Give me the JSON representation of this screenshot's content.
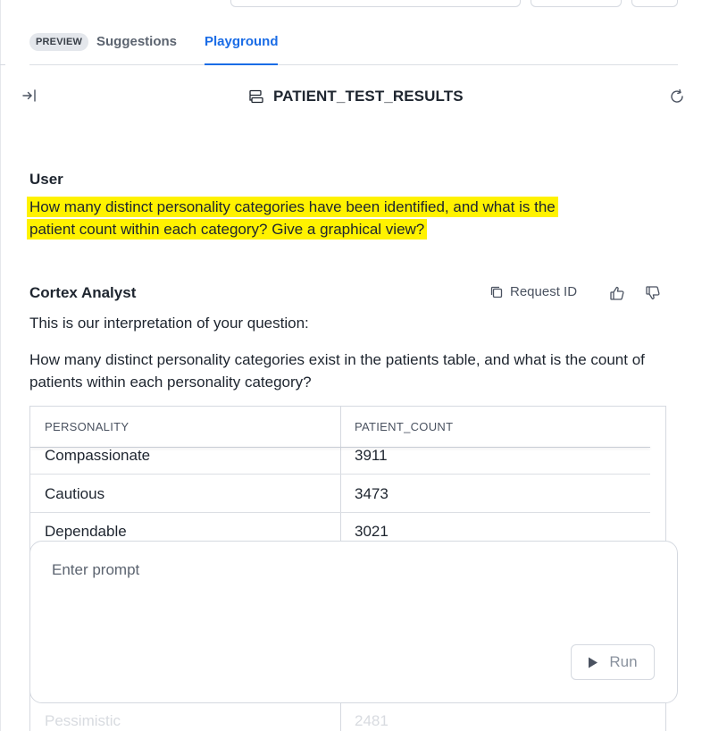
{
  "tabs": {
    "badge": "PREVIEW",
    "suggestions": "Suggestions",
    "playground": "Playground",
    "active": "Playground"
  },
  "header": {
    "title": "PATIENT_TEST_RESULTS"
  },
  "user": {
    "label": "User",
    "line1": "How many distinct personality categories have been identified, and what is the",
    "line2": "patient count within each category? Give a graphical view?"
  },
  "analyst": {
    "label": "Cortex Analyst",
    "request_id": "Request ID",
    "interpretation": "This is our interpretation of your question:",
    "question": "How many distinct personality categories exist in the patients table, and what is the count of patients within each personality category?"
  },
  "table": {
    "columns": [
      "PERSONALITY",
      "PATIENT_COUNT"
    ],
    "rows": [
      [
        "Compassionate",
        "3911"
      ],
      [
        "Cautious",
        "3473"
      ],
      [
        "Dependable",
        "3021"
      ],
      [
        "Pessimistic",
        "2481"
      ]
    ]
  },
  "prompt": {
    "placeholder": "Enter prompt",
    "run_label": "Run"
  },
  "colors": {
    "accent": "#1a6ce6",
    "highlight": "#fff200"
  }
}
